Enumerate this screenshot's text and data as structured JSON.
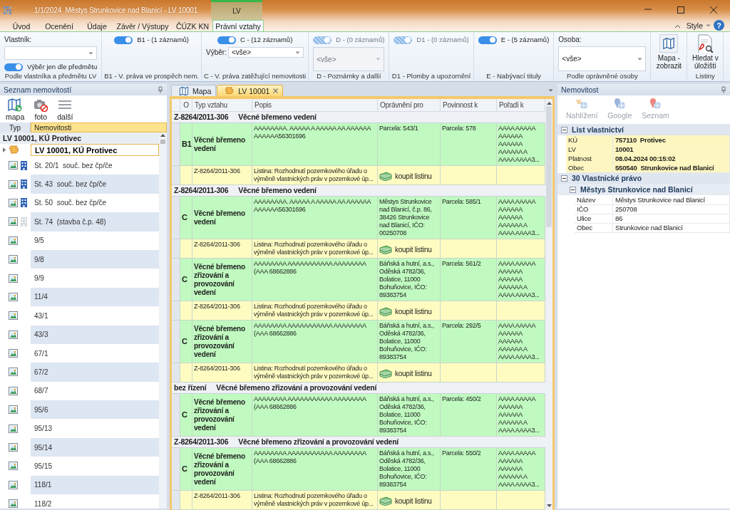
{
  "window": {
    "title": "1/1/2024  Městys Strunkovice nad Blanicí - LV 10001",
    "context_tab": "LV",
    "style_menu": "Style",
    "help": "?"
  },
  "ribbon_tabs": [
    {
      "label": "Úvod",
      "selected": false
    },
    {
      "label": "Ocenění",
      "selected": false
    },
    {
      "label": "Údaje",
      "selected": false
    },
    {
      "label": "Závěr / Výstupy",
      "selected": false
    },
    {
      "label": "ČÚZK KN",
      "selected": false
    },
    {
      "label": "Právní vztahy",
      "selected": true
    }
  ],
  "ribbon_groups": [
    {
      "label": "Podle vlastníka a předmětu LV",
      "controls": [
        {
          "kind": "caption",
          "text": "Vlastník:"
        },
        {
          "kind": "combo",
          "disabled": false
        },
        {
          "kind": "toggle",
          "label": "Výběr jen dle předmětu",
          "on": true,
          "disabled": false
        }
      ]
    },
    {
      "label": "B1 - V. práva ve prospěch nem.",
      "controls": [
        {
          "kind": "toggle",
          "label": "B1 - (1 záznamů)",
          "on": true,
          "disabled": false
        }
      ]
    },
    {
      "label": "C - V. práva zatěžující nemovitosti",
      "controls": [
        {
          "kind": "toggle",
          "label": "C - (12 záznamů)",
          "on": true,
          "disabled": false
        },
        {
          "kind": "combo",
          "label": "Výběr:",
          "value": "<vše>",
          "disabled": false
        }
      ]
    },
    {
      "label": "D - Poznámky a další",
      "controls": [
        {
          "kind": "toggle",
          "label": "D - (0 záznamů)",
          "on": true,
          "disabled": true
        },
        {
          "kind": "combo",
          "value": "<vše>",
          "disabled": true
        }
      ]
    },
    {
      "label": "D1 - Plomby a upozornění",
      "controls": [
        {
          "kind": "toggle",
          "label": "D1 - (0 záznamů)",
          "on": true,
          "disabled": true
        }
      ]
    },
    {
      "label": "E - Nabývací tituly",
      "controls": [
        {
          "kind": "toggle",
          "label": "E - (5 záznamů)",
          "on": true,
          "disabled": false
        }
      ]
    },
    {
      "label": "Podle oprávněné osoby",
      "controls": [
        {
          "kind": "caption",
          "text": "Osoba:"
        },
        {
          "kind": "combo",
          "value": "<vše>",
          "disabled": false
        }
      ]
    },
    {
      "controls": [
        {
          "kind": "mapbutton",
          "label": "Mapa - zobrazit",
          "dropdown": true
        }
      ]
    },
    {
      "label": "Listiny",
      "controls": [
        {
          "kind": "docbutton",
          "label": "Hledat v úložišti",
          "dropdown": false
        }
      ]
    }
  ],
  "property_list": {
    "title": "Seznam nemovitostí",
    "tools": [
      {
        "kind": "map",
        "label": "mapa"
      },
      {
        "kind": "photo",
        "label": "foto"
      },
      {
        "kind": "menu",
        "label": "další"
      }
    ],
    "columns": [
      "Typ",
      "Nemovitosti"
    ],
    "group": "LV 10001, KÚ Protivec",
    "items": [
      {
        "kind": "lv",
        "label": "LV 10001, KÚ Protivec",
        "selected": true
      },
      {
        "kind": "building",
        "label": "St. 20/1  souč. bez čp/če",
        "selected": false
      },
      {
        "kind": "building",
        "label": "St. 43  souč. bez čp/če",
        "selected": false
      },
      {
        "kind": "building",
        "label": "St. 50  souč. bez čp/če",
        "selected": false
      },
      {
        "kind": "outline",
        "label": "St. 74  (stavba č.p. 48)",
        "selected": false
      },
      {
        "kind": "parcel",
        "label": "9/5",
        "selected": false
      },
      {
        "kind": "parcel",
        "label": "9/8",
        "selected": false
      },
      {
        "kind": "parcel",
        "label": "9/9",
        "selected": false
      },
      {
        "kind": "parcel",
        "label": "11/4",
        "selected": false
      },
      {
        "kind": "parcel",
        "label": "43/1",
        "selected": false
      },
      {
        "kind": "parcel",
        "label": "43/3",
        "selected": false
      },
      {
        "kind": "parcel",
        "label": "67/1",
        "selected": false
      },
      {
        "kind": "parcel",
        "label": "67/2",
        "selected": false
      },
      {
        "kind": "parcel",
        "label": "68/7",
        "selected": false
      },
      {
        "kind": "parcel",
        "label": "95/6",
        "selected": false
      },
      {
        "kind": "parcel",
        "label": "95/13",
        "selected": false
      },
      {
        "kind": "parcel",
        "label": "95/14",
        "selected": false
      },
      {
        "kind": "parcel",
        "label": "95/15",
        "selected": false
      },
      {
        "kind": "parcel",
        "label": "118/1",
        "selected": false
      },
      {
        "kind": "parcel",
        "label": "118/2",
        "selected": false
      }
    ]
  },
  "documents": {
    "tabs": [
      {
        "kind": "map",
        "label": "Mapa",
        "selected": false,
        "closable": false
      },
      {
        "kind": "lv",
        "label": "LV 10001",
        "selected": true,
        "closable": true
      }
    ],
    "grid": {
      "columns": [
        "O",
        "Typ vztahu",
        "Popis",
        "Oprávnění pro",
        "Povinnost k",
        "Pořadí k"
      ],
      "groups": [
        {
          "code": "Z-8264/2011-306",
          "title": "Věcné břemeno vedení",
          "rows": [
            {
              "kind": "right",
              "part": "B1",
              "type": "Věcné břemeno vedení",
              "description": "AAAAAAAA. AAAAA A AAAAA AA AAAAAA AAAAAA56301696",
              "entitled": "Parcela: 543/1",
              "obliged": "Parcela: 578",
              "order": "AAAA AAAAA AAAAAA AAAAAA AAAAAA A AAAA AAAA3..."
            },
            {
              "kind": "deed",
              "code": "Z-8264/2011-306",
              "description": "Listina:  Rozhodnutí pozemkového úřadu o výměně vlastnických práv v pozemkové úp...",
              "action": "koupit listinu"
            }
          ]
        },
        {
          "code": "Z-8264/2011-306",
          "title": "Věcné břemeno vedení",
          "rows": [
            {
              "kind": "right",
              "part": "C",
              "type": "Věcné břemeno vedení",
              "description": "AAAAAAAA. AAAAA A AAAAA AA AAAAAA AAAAAA56301696",
              "entitled": "Městys Strunkovice nad Blanicí, č.p.  86, 38426 Strunkovice nad Blanicí, IČO: 00250708",
              "obliged": "Parcela: 585/1",
              "order": "AAAA AAAAA AAAAAA AAAAAA AAAAAA A AAAA AAAA3..."
            },
            {
              "kind": "deed",
              "code": "Z-8264/2011-306",
              "description": "Listina:  Rozhodnutí pozemkového úřadu o výměně vlastnických práv v pozemkové úp...",
              "action": "koupit listinu"
            },
            {
              "kind": "right",
              "part": "C",
              "type": "Věcné břemeno zřizování a provozování vedení",
              "description": "AAAAAAAA AAAAAAAAAAA AAAAAAAA (AAA 68662886",
              "entitled": "Báňská a hutní, a.s., Oděská 4782/36, Bolatice, 11000 Bohuňovice, IČO: 89383754",
              "obliged": "Parcela: 561/2",
              "order": "AAAA AAAAA AAAAAA AAAAAA AAAAAA A AAAA AAAA3..."
            },
            {
              "kind": "deed",
              "code": "Z-8264/2011-306",
              "description": "Listina:  Rozhodnutí pozemkového úřadu o výměně vlastnických práv v pozemkové úp...",
              "action": "koupit listinu"
            },
            {
              "kind": "right",
              "part": "C",
              "type": "Věcné břemeno zřizování a provozování vedení",
              "description": "AAAAAAAA AAAAAAAAAAA AAAAAAAA (AAA 68662886",
              "entitled": "Báňská a hutní, a.s., Oděská 4782/36, Bolatice, 11000 Bohuňovice, IČO: 89383754",
              "obliged": "Parcela: 292/5",
              "order": "AAAA AAAAA AAAAAA AAAAAA AAAAAA A AAAA AAAA3..."
            },
            {
              "kind": "deed",
              "code": "Z-8264/2011-306",
              "description": "Listina:  Rozhodnutí pozemkového úřadu o výměně vlastnických práv v pozemkové úp...",
              "action": "koupit listinu"
            }
          ]
        },
        {
          "code": "bez řízení",
          "title": "Věcné břemeno zřizování a provozování vedení",
          "rows": [
            {
              "kind": "right",
              "part": "C",
              "type": "Věcné břemeno zřizování a provozování vedení",
              "description": "AAAAAAAA AAAAAAAAAAA AAAAAAAA (AAA 68662886",
              "entitled": "Báňská a hutní, a.s., Oděská 4782/36, Bolatice, 11000 Bohuňovice, IČO: 89383754",
              "obliged": "Parcela: 450/2",
              "order": "AAAA AAAAA AAAAAA AAAAAA AAAAAA A AAAA AAAA3..."
            }
          ]
        },
        {
          "code": "Z-8264/2011-306",
          "title": "Věcné břemeno zřizování a provozování vedení",
          "rows": [
            {
              "kind": "right",
              "part": "C",
              "type": "Věcné břemeno zřizování a provozování vedení",
              "description": "AAAAAAAA AAAAAAAAAAA AAAAAAAA (AAA 68662886",
              "entitled": "Báňská a hutní, a.s., Oděská 4782/36, Bolatice, 11000 Bohuňovice, IČO: 89383754",
              "obliged": "Parcela: 550/2",
              "order": "AAAA AAAAA AAAAAA AAAAAA AAAAAA A AAAA AAAA3..."
            },
            {
              "kind": "deed",
              "code": "Z-8264/2011-306",
              "description": "Listina:  Rozhodnutí pozemkového úřadu o výměně vlastnických práv v pozemkové úp...",
              "action": "koupit listinu"
            }
          ]
        }
      ]
    }
  },
  "property_detail": {
    "title": "Nemovitost",
    "tools": [
      {
        "kind": "cadastre",
        "label": "Nahlížení",
        "disabled": true
      },
      {
        "kind": "google",
        "label": "Google",
        "disabled": true
      },
      {
        "kind": "seznam",
        "label": "Seznam",
        "disabled": true
      }
    ],
    "sections": [
      {
        "title": "List vlastnictví",
        "expanded": true,
        "rows": [
          {
            "name": "KÚ",
            "value": "757110  Protivec"
          },
          {
            "name": "LV",
            "value": "10001"
          },
          {
            "name": "Platnost",
            "value": "08.04.2024 00:15:02"
          },
          {
            "name": "Obec",
            "value": "550540  Strunkovice nad Blanicí"
          }
        ]
      },
      {
        "title": "30 Vlastnické právo",
        "expanded": true,
        "children": [
          {
            "title": "Městys Strunkovice nad Blanicí",
            "expanded": true,
            "rows": [
              {
                "name": "Název",
                "value": "Městys Strunkovice nad Blanicí"
              },
              {
                "name": "IČO",
                "value": "250708"
              },
              {
                "name": "Ulice",
                "value": "86"
              },
              {
                "name": "Obec",
                "value": "Strunkovice nad Blanicí"
              }
            ]
          }
        ]
      }
    ]
  }
}
